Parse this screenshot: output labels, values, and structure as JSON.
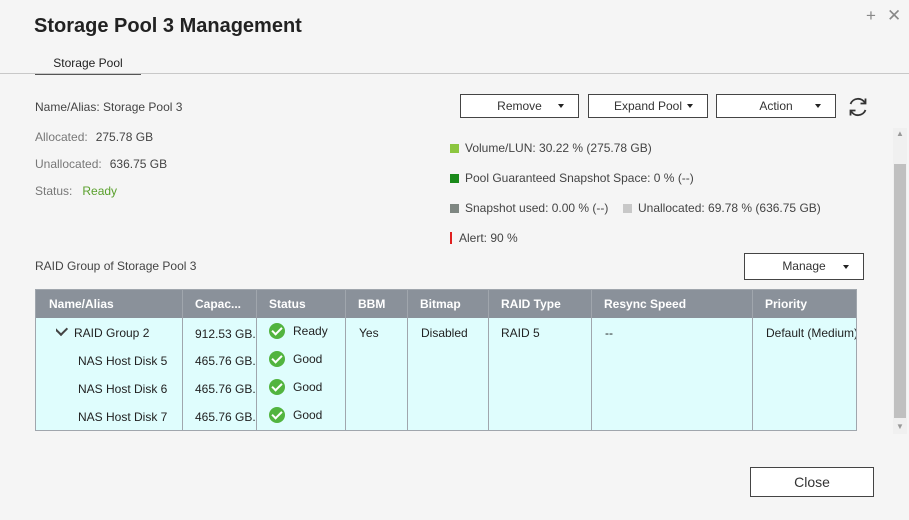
{
  "dialog": {
    "title": "Storage Pool 3 Management",
    "add_icon": "+",
    "close_icon": "✕"
  },
  "tabs": [
    {
      "label": "Storage Pool",
      "active": true
    }
  ],
  "pool": {
    "name_label": "Name/Alias: Storage Pool 3",
    "allocated_label": "Allocated:",
    "allocated_value": "275.78 GB",
    "unallocated_label": "Unallocated:",
    "unallocated_value": "636.75 GB",
    "status_label": "Status:",
    "status_value": "Ready"
  },
  "toolbar": {
    "remove_label": "Remove",
    "expand_label": "Expand Pool",
    "action_label": "Action",
    "refresh_icon": "refresh-icon"
  },
  "legend": {
    "volume": "Volume/LUN: 30.22 % (275.78 GB)",
    "guaranteed": "Pool Guaranteed Snapshot Space: 0 % (--)",
    "snapshot": "Snapshot used: 0.00 % (--)",
    "unallocated": "Unallocated: 69.78 % (636.75 GB)",
    "alert": "Alert: 90 %",
    "colors": {
      "volume": "#8cc63f",
      "guaranteed": "#1a8a1a",
      "snapshot": "#7f8782",
      "unallocated": "#c8c8c8",
      "alert": "#e02020"
    }
  },
  "raid_section": {
    "title": "RAID Group of Storage Pool 3",
    "manage_label": "Manage"
  },
  "table": {
    "headers": [
      "Name/Alias",
      "Capac...",
      "Status",
      "BBM",
      "Bitmap",
      "RAID Type",
      "Resync Speed",
      "Priority"
    ],
    "group": {
      "name": "RAID Group 2",
      "capacity": "912.53 GB...",
      "status": "Ready",
      "bbm": "Yes",
      "bitmap": "Disabled",
      "raid_type": "RAID 5",
      "resync": "--",
      "priority": "Default (Medium)"
    },
    "disks": [
      {
        "name": "NAS Host Disk 5",
        "capacity": "465.76 GB...",
        "status": "Good"
      },
      {
        "name": "NAS Host Disk 6",
        "capacity": "465.76 GB...",
        "status": "Good"
      },
      {
        "name": "NAS Host Disk 7",
        "capacity": "465.76 GB...",
        "status": "Good"
      }
    ]
  },
  "footer": {
    "close_label": "Close"
  }
}
